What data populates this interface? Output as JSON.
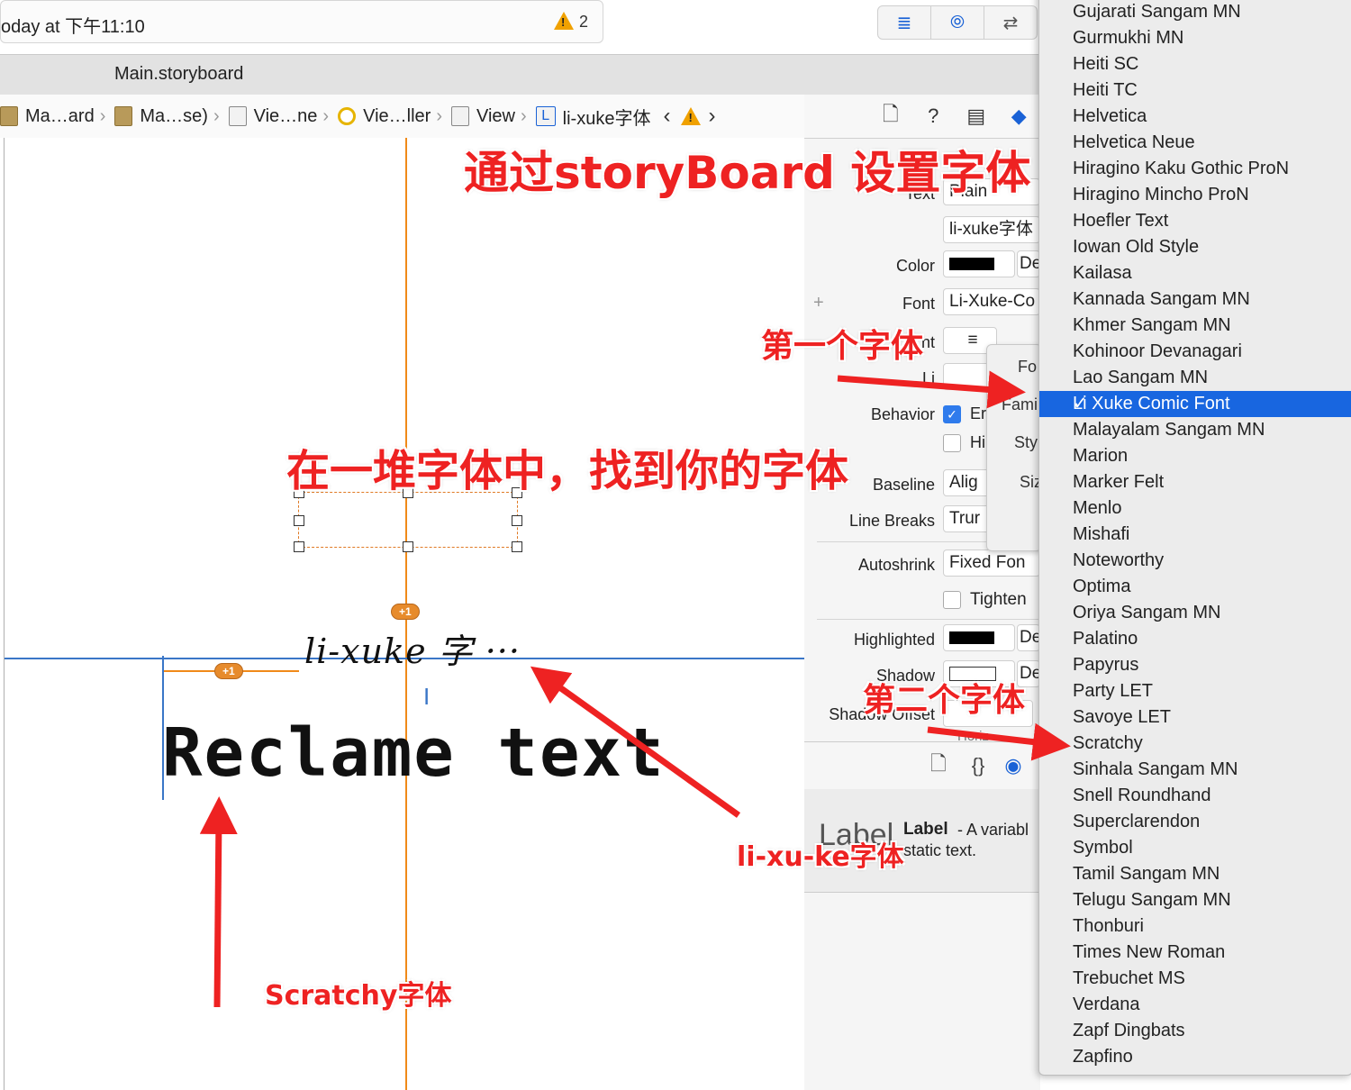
{
  "status_bar": {
    "text": "oday at 下午11:10",
    "warning_count": "2"
  },
  "tab_bar": {
    "title": "Main.storyboard"
  },
  "breadcrumbs": [
    "Ma…ard",
    "Ma…se)",
    "Vie…ne",
    "Vie…ller",
    "View",
    "li-xuke字体"
  ],
  "inspector": {
    "text_label": "Text",
    "text_value": "Plain",
    "content_value": "li-xuke字体",
    "color_label": "Color",
    "color_value": "De",
    "font_label": "Font",
    "font_value": "Li-Xuke-Co",
    "alignment_label": "nt",
    "lines_label": "Li",
    "behavior_label": "Behavior",
    "behavior_enabled": "Er",
    "behavior_highlighted": "Hi",
    "baseline_label": "Baseline",
    "baseline_value": "Alig",
    "line_breaks_label": "Line Breaks",
    "line_breaks_value": "Trur",
    "autoshrink_label": "Autoshrink",
    "autoshrink_value": "Fixed Fon",
    "tighten_label": "Tighten",
    "highlighted_label": "Highlighted",
    "highlighted_value": "De",
    "shadow_label": "Shadow",
    "shadow_value": "De",
    "shadow_offset_label": "Shadow Offset",
    "horiz_label": "Horiz",
    "plus": "+"
  },
  "font_popover": {
    "font": "Fo",
    "family": "Fami",
    "style": "Sty",
    "size": "Siz"
  },
  "library": {
    "title": "Label",
    "desc1": " - A variabl",
    "desc2": "static text.",
    "preview": "Label"
  },
  "canvas": {
    "label_text": "li-xuke 字 ···",
    "reclame_text": "Reclame text",
    "badge_top": "+1",
    "badge_left": "+1",
    "cursor": "I"
  },
  "font_list": {
    "selected": "Li Xuke Comic Font",
    "items": [
      "Gujarati Sangam MN",
      "Gurmukhi MN",
      "Heiti SC",
      "Heiti TC",
      "Helvetica",
      "Helvetica Neue",
      "Hiragino Kaku Gothic ProN",
      "Hiragino Mincho ProN",
      "Hoefler Text",
      "Iowan Old Style",
      "Kailasa",
      "Kannada Sangam MN",
      "Khmer Sangam MN",
      "Kohinoor Devanagari",
      "Lao Sangam MN",
      "Li Xuke Comic Font",
      "Malayalam Sangam MN",
      "Marion",
      "Marker Felt",
      "Menlo",
      "Mishafi",
      "Noteworthy",
      "Optima",
      "Oriya Sangam MN",
      "Palatino",
      "Papyrus",
      "Party LET",
      "Savoye LET",
      "Scratchy",
      "Sinhala Sangam MN",
      "Snell Roundhand",
      "Superclarendon",
      "Symbol",
      "Tamil Sangam MN",
      "Telugu Sangam MN",
      "Thonburi",
      "Times New Roman",
      "Trebuchet MS",
      "Verdana",
      "Zapf Dingbats",
      "Zapfino"
    ]
  },
  "annotations": {
    "title": "通过storyBoard 设置字体",
    "first_font": "第一个字体",
    "find_font": "在一堆字体中，找到你的字体",
    "second_font": "第二个字体",
    "lixuke_font": "li-xu-ke字体",
    "scratchy_font": "Scratchy字体"
  },
  "colors": {
    "annotation": "#ee2222",
    "selection": "#1866e0",
    "guide": "#f08a19",
    "constraint": "#3a76c7"
  }
}
